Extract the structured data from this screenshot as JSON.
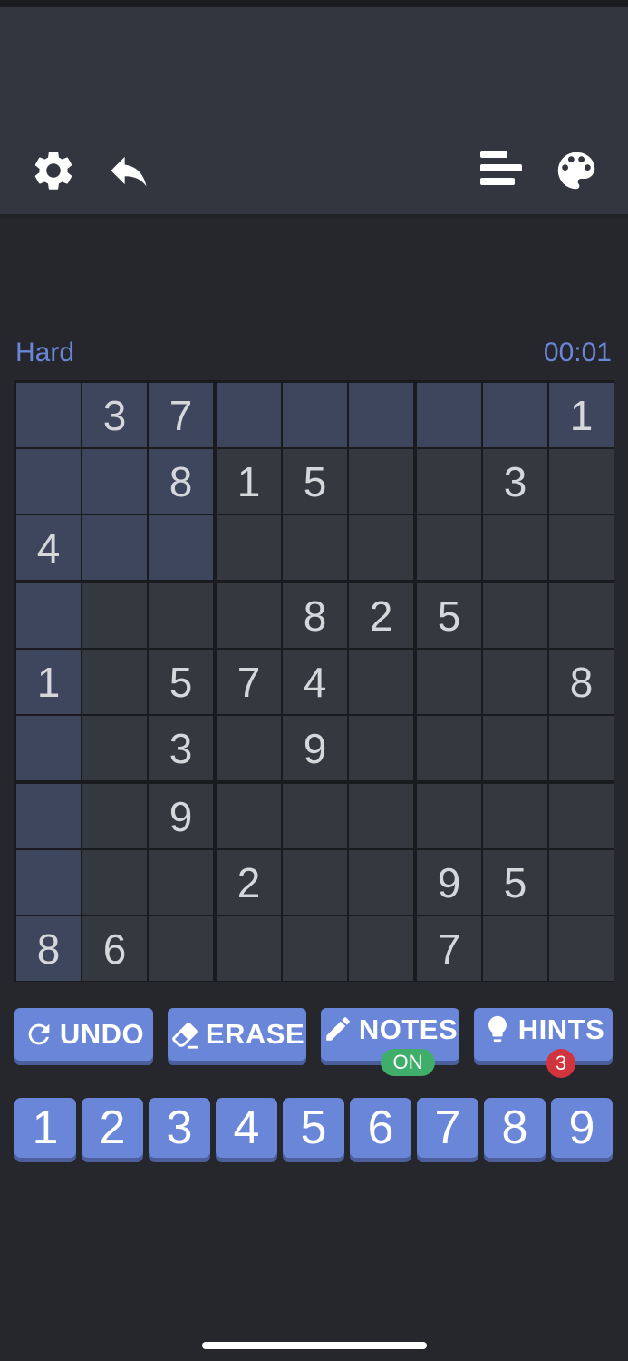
{
  "header": {
    "icons": [
      "gear-icon",
      "undo-arrow-icon",
      "stats-icon",
      "palette-icon"
    ]
  },
  "game": {
    "difficulty": "Hard",
    "timer": "00:01"
  },
  "board": {
    "rows": [
      [
        "",
        "3",
        "7",
        "",
        "",
        "",
        "",
        "",
        "1"
      ],
      [
        "",
        "",
        "8",
        "1",
        "5",
        "",
        "",
        "3",
        ""
      ],
      [
        "4",
        "",
        "",
        "",
        "",
        "",
        "",
        "",
        ""
      ],
      [
        "",
        "",
        "",
        "",
        "8",
        "2",
        "5",
        "",
        ""
      ],
      [
        "1",
        "",
        "5",
        "7",
        "4",
        "",
        "",
        "",
        "8"
      ],
      [
        "",
        "",
        "3",
        "",
        "9",
        "",
        "",
        "",
        ""
      ],
      [
        "",
        "",
        "9",
        "",
        "",
        "",
        "",
        "",
        ""
      ],
      [
        "",
        "",
        "",
        "2",
        "",
        "",
        "9",
        "5",
        ""
      ],
      [
        "8",
        "6",
        "",
        "",
        "",
        "",
        "7",
        "",
        ""
      ]
    ],
    "highlighted_row": 0,
    "highlighted_col": 0,
    "colors": {
      "cell": "#363840",
      "highlight": "#3e465e",
      "lines": "#1a1b1f"
    }
  },
  "actions": {
    "undo": "UNDO",
    "erase": "ERASE",
    "notes": "NOTES",
    "notes_state": "ON",
    "hints": "HINTS",
    "hints_count": "3"
  },
  "numpad": [
    "1",
    "2",
    "3",
    "4",
    "5",
    "6",
    "7",
    "8",
    "9"
  ],
  "colors": {
    "accent": "#6a86d8",
    "header": "#34363f",
    "background": "#26272c",
    "badge_on": "#3fae6a",
    "badge_hint": "#d2343e"
  }
}
